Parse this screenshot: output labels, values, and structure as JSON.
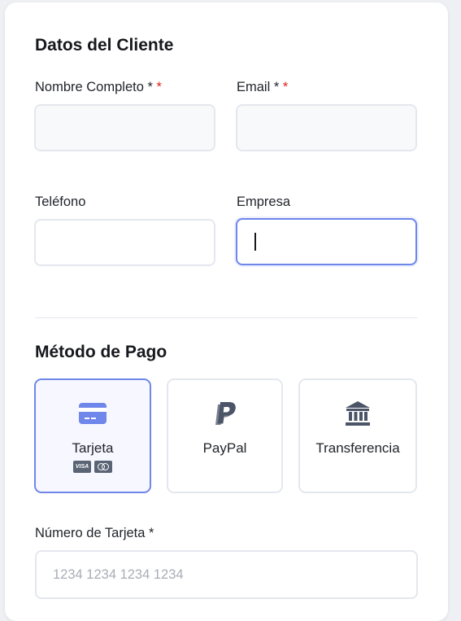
{
  "customer_section": {
    "title": "Datos del Cliente",
    "fields": {
      "full_name": {
        "label": "Nombre Completo",
        "req_plain": "*",
        "req_red": "*",
        "value": ""
      },
      "email": {
        "label": "Email",
        "req_plain": "*",
        "req_red": "*",
        "value": ""
      },
      "phone": {
        "label": "Teléfono",
        "value": ""
      },
      "company": {
        "label": "Empresa",
        "value": ""
      }
    }
  },
  "payment_section": {
    "title": "Método de Pago",
    "options": [
      {
        "label": "Tarjeta",
        "icon": "credit-card-icon",
        "selected": true,
        "brands": [
          "VISA",
          "mastercard"
        ]
      },
      {
        "label": "PayPal",
        "icon": "paypal-icon",
        "selected": false
      },
      {
        "label": "Transferencia",
        "icon": "bank-icon",
        "selected": false
      }
    ],
    "card_number": {
      "label": "Número de Tarjeta",
      "req_plain": "*",
      "placeholder": "1234 1234 1234 1234",
      "value": ""
    }
  },
  "colors": {
    "accent": "#6f86ea",
    "required": "#e02020",
    "icon": "#4b5567",
    "border": "#e4e7ee"
  }
}
